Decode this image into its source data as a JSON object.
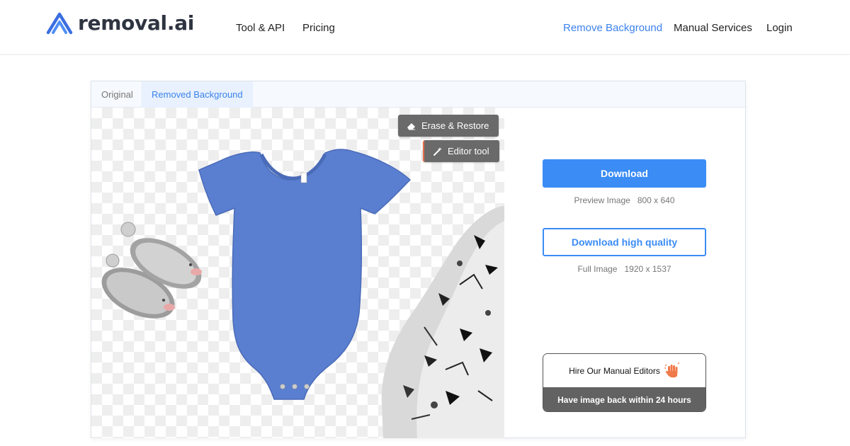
{
  "brand": {
    "name": "removal.ai"
  },
  "nav": {
    "tool_api": "Tool & API",
    "pricing": "Pricing",
    "remove_background": "Remove Background",
    "manual_services": "Manual Services",
    "login": "Login"
  },
  "tabs": {
    "original": "Original",
    "removed": "Removed Background",
    "active": "removed"
  },
  "tools": {
    "erase_restore": {
      "label": "Erase & Restore",
      "icon": "eraser-icon"
    },
    "editor_tool": {
      "label": "Editor tool",
      "icon": "magic-wand-icon"
    }
  },
  "download": {
    "label": "Download",
    "preview_text": "Preview Image   800 x 640"
  },
  "download_hq": {
    "label": "Download high quality",
    "full_text": "Full Image   1920 x 1537"
  },
  "hire": {
    "title": "Hire Our Manual Editors",
    "subtitle": "Have image back within 24 hours",
    "icon": "hand-wave-icon"
  },
  "colors": {
    "accent": "#3b8cf5",
    "nav_active": "#3c82ec",
    "onesie": "#5a7fd0",
    "tool_bg": "#6a6a6a"
  }
}
